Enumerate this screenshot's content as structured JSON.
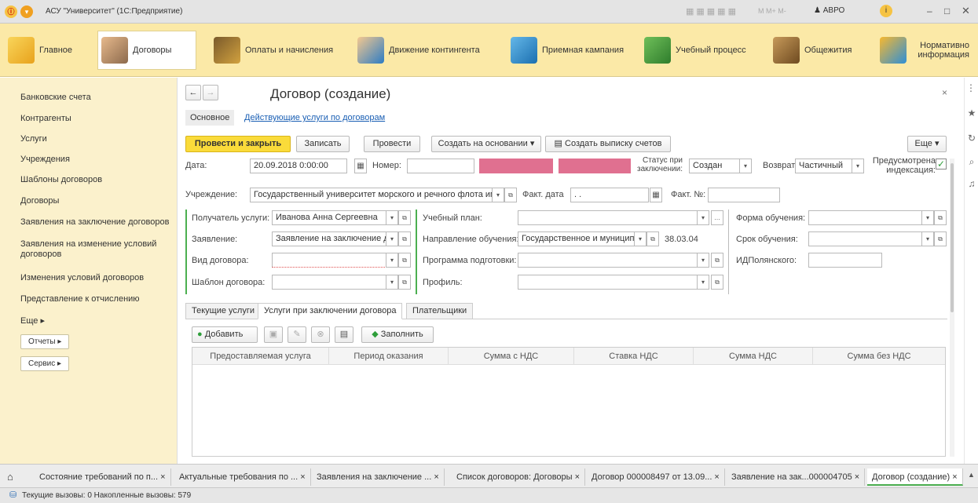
{
  "window": {
    "title": "АСУ \"Университет\" (1С:Предприятие)"
  },
  "nav": {
    "items": [
      {
        "label": "Главное"
      },
      {
        "label": "Договоры"
      },
      {
        "label": "Оплаты и начисления"
      },
      {
        "label": "Движение контингента"
      },
      {
        "label": "Приемная кампания"
      },
      {
        "label": "Учебный процесс"
      },
      {
        "label": "Общежития"
      },
      {
        "label": "Нормативно информация"
      }
    ]
  },
  "toolbar_right": {
    "user": "АВРО",
    "panel": "М  М+  М-"
  },
  "sidebar": {
    "items": [
      "Банковские счета",
      "Контрагенты",
      "Услуги",
      "Учреждения",
      "Шаблоны договоров",
      "Договоры",
      "Заявления на заключение договоров",
      "Заявления на изменение условий договоров",
      "Изменения условий договоров",
      "Представление к отчислению",
      "Еще ▸"
    ],
    "buttons": [
      "Отчеты ▸",
      "Сервис ▸"
    ]
  },
  "form": {
    "title": "Договор (создание)",
    "subnav": [
      "Основное",
      "Действующие услуги по договорам"
    ],
    "buttons": {
      "post_close": "Провести и закрыть",
      "save": "Записать",
      "post": "Провести",
      "create_based": "Создать на основании",
      "create_statement": "Создать выписку счетов",
      "more": "Еще"
    },
    "date_label": "Дата:",
    "date_value": "20.09.2018 0:00:00",
    "number_label": "Номер:",
    "status_label": "Статус при заключении:",
    "status_value": "Создан",
    "return_label": "Возврат:",
    "return_value": "Частичный",
    "indexation_label": "Предусмотрена индексация:",
    "institution_label": "Учреждение:",
    "institution_value": "Государственный университет морского и речного флота им",
    "fact_date_label": "Факт. дата",
    "fact_date_value": " .  .",
    "fact_no_label": "Факт. №:",
    "recipient_label": "Получатель услуги:",
    "recipient_value": "Иванова Анна Сергеевна",
    "application_label": "Заявление:",
    "application_value": "Заявление на заключение д",
    "contract_type_label": "Вид договора:",
    "template_label": "Шаблон договора:",
    "plan_label": "Учебный план:",
    "direction_label": "Направление обучения:",
    "direction_value": "Государственное и муниципа",
    "direction_code": "38.03.04",
    "program_label": "Программа подготовки:",
    "profile_label": "Профиль:",
    "study_form_label": "Форма обучения:",
    "study_term_label": "Срок обучения:",
    "id_label": "ИДПолянского:",
    "tabs": [
      "Текущие услуги",
      "Услуги при заключении договора",
      "Плательщики"
    ],
    "add_label": "Добавить",
    "fill_label": "Заполнить",
    "columns": [
      "Предоставляемая услуга",
      "Период оказания",
      "Сумма с НДС",
      "Ставка НДС",
      "Сумма НДС",
      "Сумма без НДС"
    ]
  },
  "bottom_tabs": [
    "Состояние требований по п... ×",
    "Актуальные требования по ... ×",
    "Заявления на заключение ... ×",
    "Список договоров: Договоры ×",
    "Договор 000008497 от 13.09... ×",
    "Заявление на зак...000004705 ×",
    "Договор (создание) ×"
  ],
  "status": {
    "text": "Текущие вызовы: 0   Накопленные вызовы: 579"
  },
  "colors": {
    "accent": "#fadb3a",
    "nav_bg": "#fbe9a7",
    "sidebar_bg": "#fbf1cc",
    "green": "#4caf50",
    "redacted": "#e07090"
  }
}
